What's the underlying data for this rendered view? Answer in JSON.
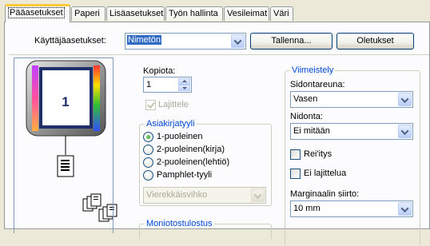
{
  "tabs": [
    {
      "label": "Pääasetukset",
      "active": true
    },
    {
      "label": "Paperi"
    },
    {
      "label": "Lisäasetukset"
    },
    {
      "label": "Työn hallinta"
    },
    {
      "label": "Vesileimat"
    },
    {
      "label": "Väri"
    }
  ],
  "user_settings": {
    "label": "Käyttäjäasetukset:",
    "value": "Nimetön",
    "save_button": "Tallenna...",
    "defaults_button": "Oletukset"
  },
  "preview": {
    "page_number": "1"
  },
  "copies": {
    "label": "Kopiota:",
    "value": "1"
  },
  "collate": {
    "label": "Lajittele",
    "checked": true,
    "enabled": false
  },
  "document_style": {
    "title": "Asiakirjatyyli",
    "options": [
      "1-puoleinen",
      "2-puoleinen(kirja)",
      "2-puoleinen(lehtiö)",
      "Pamphlet-tyyli"
    ],
    "selected": 0,
    "pamphlet_select": "Vierekkäisvihko"
  },
  "multi_output": {
    "title": "Moniotostulostus"
  },
  "finishing": {
    "title": "Viimeistely",
    "binding_label": "Sidontareuna:",
    "binding_value": "Vasen",
    "staple_label": "Nidonta:",
    "staple_value": "Ei mitään",
    "punch_label": "Rei'itys",
    "no_collate_label": "Ei lajittelua",
    "margin_label": "Marginaalin siirto:",
    "margin_value": "10 mm"
  },
  "colors": {
    "accent": "#FFC83C",
    "group_title": "#0046D5",
    "selection": "#316AC5"
  }
}
